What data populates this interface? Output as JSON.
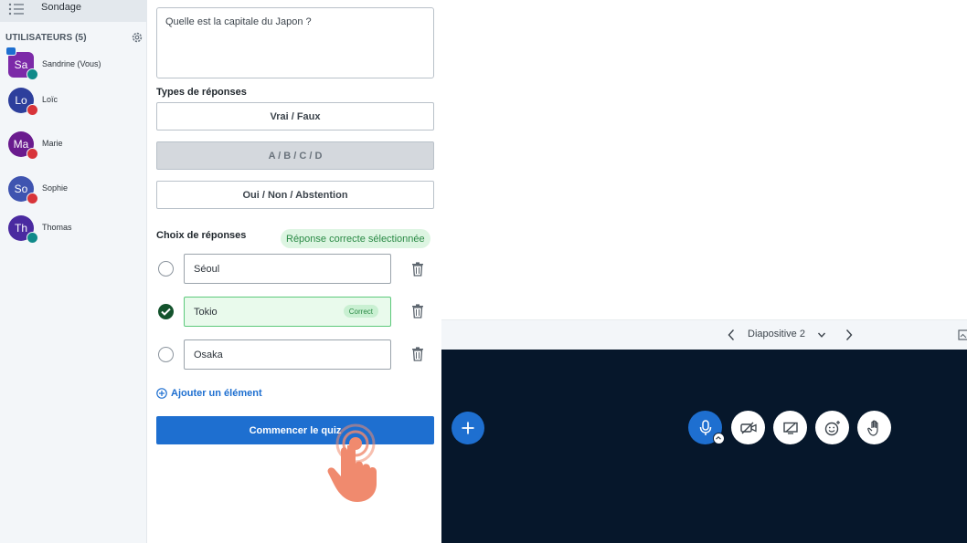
{
  "sidebar": {
    "poll_item_label": "Sondage",
    "users_heading": "UTILISATEURS (5)",
    "users": [
      {
        "initials": "Sa",
        "name": "Sandrine (Vous)",
        "color": "#7c2aa8",
        "badge_color": "#0f8a8a",
        "shape": "square",
        "presenter": true
      },
      {
        "initials": "Lo",
        "name": "Loïc",
        "color": "#2d3f9c",
        "badge_color": "#d8343a",
        "shape": "round"
      },
      {
        "initials": "Ma",
        "name": "Marie",
        "color": "#6a1b8e",
        "badge_color": "#d8343a",
        "shape": "round"
      },
      {
        "initials": "So",
        "name": "Sophie",
        "color": "#3f54b0",
        "badge_color": "#d8343a",
        "shape": "round"
      },
      {
        "initials": "Th",
        "name": "Thomas",
        "color": "#4a2aa0",
        "badge_color": "#0f8a8a",
        "shape": "round"
      }
    ]
  },
  "poll": {
    "question": "Quelle est la capitale du Japon ?",
    "types_title": "Types de réponses",
    "types": [
      "Vrai / Faux",
      "A / B / C / D",
      "Oui / Non / Abstention"
    ],
    "active_type": "A / B / C / D",
    "choices_title": "Choix de réponses",
    "correct_selected_label": "Réponse correcte sélectionnée",
    "answers": [
      {
        "value": "Séoul",
        "correct": false
      },
      {
        "value": "Tokio",
        "correct": true
      },
      {
        "value": "Osaka",
        "correct": false
      }
    ],
    "correct_pill": "Correct",
    "add_item_label": "Ajouter un élément",
    "start_label": "Commencer le quiz"
  },
  "presentation": {
    "slide_label": "Diapositive 2"
  },
  "colors": {
    "accent": "#1e6fd0",
    "dark_stage": "#06172b",
    "success": "#2a8a45"
  }
}
